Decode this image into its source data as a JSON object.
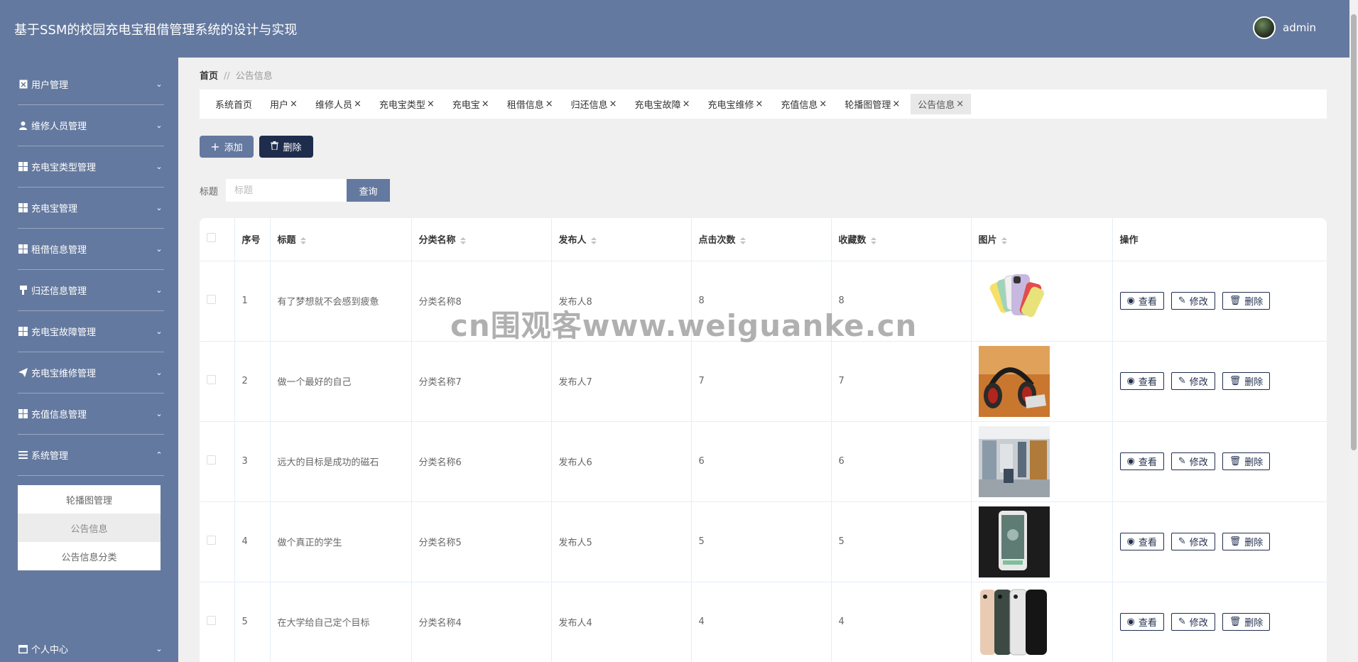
{
  "header": {
    "app_title": "基于SSM的校园充电宝租借管理系统的设计与实现",
    "username": "admin"
  },
  "sidebar": {
    "items": [
      {
        "label": "用户管理",
        "icon": "id-card-icon",
        "expanded": false
      },
      {
        "label": "维修人员管理",
        "icon": "user-icon",
        "expanded": false
      },
      {
        "label": "充电宝类型管理",
        "icon": "grid-icon",
        "expanded": false
      },
      {
        "label": "充电宝管理",
        "icon": "grid-icon",
        "expanded": false
      },
      {
        "label": "租借信息管理",
        "icon": "grid-icon",
        "expanded": false
      },
      {
        "label": "归还信息管理",
        "icon": "thumbs-down-icon",
        "expanded": false
      },
      {
        "label": "充电宝故障管理",
        "icon": "grid-icon",
        "expanded": false
      },
      {
        "label": "充电宝维修管理",
        "icon": "paper-plane-icon",
        "expanded": false
      },
      {
        "label": "充值信息管理",
        "icon": "grid-icon",
        "expanded": false
      },
      {
        "label": "系统管理",
        "icon": "list-icon",
        "expanded": true
      },
      {
        "label": "个人中心",
        "icon": "window-icon",
        "expanded": false
      }
    ],
    "submenu": [
      {
        "label": "轮播图管理",
        "active": false
      },
      {
        "label": "公告信息",
        "active": true
      },
      {
        "label": "公告信息分类",
        "active": false
      }
    ]
  },
  "breadcrumb": {
    "home": "首页",
    "separator": "//",
    "current": "公告信息"
  },
  "tabs": [
    {
      "label": "系统首页",
      "closable": false,
      "active": false
    },
    {
      "label": "用户",
      "closable": true,
      "active": false
    },
    {
      "label": "维修人员",
      "closable": true,
      "active": false
    },
    {
      "label": "充电宝类型",
      "closable": true,
      "active": false
    },
    {
      "label": "充电宝",
      "closable": true,
      "active": false
    },
    {
      "label": "租借信息",
      "closable": true,
      "active": false
    },
    {
      "label": "归还信息",
      "closable": true,
      "active": false
    },
    {
      "label": "充电宝故障",
      "closable": true,
      "active": false
    },
    {
      "label": "充电宝维修",
      "closable": true,
      "active": false
    },
    {
      "label": "充值信息",
      "closable": true,
      "active": false
    },
    {
      "label": "轮播图管理",
      "closable": true,
      "active": false
    },
    {
      "label": "公告信息",
      "closable": true,
      "active": true
    }
  ],
  "tab_close_glyph": "×",
  "toolbar": {
    "add_label": "添加",
    "delete_label": "删除"
  },
  "search": {
    "label": "标题",
    "placeholder": "标题",
    "value": "",
    "button_label": "查询"
  },
  "table": {
    "columns": [
      "序号",
      "标题",
      "分类名称",
      "发布人",
      "点击次数",
      "收藏数",
      "图片",
      "操作"
    ],
    "sortable": [
      false,
      true,
      true,
      true,
      true,
      true,
      true,
      false
    ],
    "rows": [
      {
        "index": "1",
        "title": "有了梦想就不会感到疲惫",
        "category": "分类名称8",
        "publisher": "发布人8",
        "clicks": "8",
        "favorites": "8",
        "image": "colorful-phones-photo"
      },
      {
        "index": "2",
        "title": "做一个最好的自己",
        "category": "分类名称7",
        "publisher": "发布人7",
        "clicks": "7",
        "favorites": "7",
        "image": "headphones-photo"
      },
      {
        "index": "3",
        "title": "远大的目标是成功的磁石",
        "category": "分类名称6",
        "publisher": "发布人6",
        "clicks": "6",
        "favorites": "6",
        "image": "store-interior-photo"
      },
      {
        "index": "4",
        "title": "做个真正的学生",
        "category": "分类名称5",
        "publisher": "发布人5",
        "clicks": "5",
        "favorites": "5",
        "image": "phone-in-hand-photo"
      },
      {
        "index": "5",
        "title": "在大学给自己定个目标",
        "category": "分类名称4",
        "publisher": "发布人4",
        "clicks": "4",
        "favorites": "4",
        "image": "phone-lineup-photo"
      }
    ],
    "actions": {
      "view": "查看",
      "edit": "修改",
      "delete": "删除"
    }
  },
  "watermark": "cn围观客www.weiguanke.cn",
  "colors": {
    "primary": "#64799f",
    "dark": "#1f2d4d",
    "background": "#f0f0f0"
  }
}
